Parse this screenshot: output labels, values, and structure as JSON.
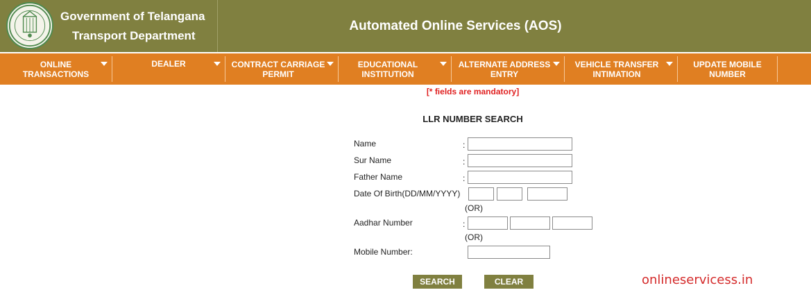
{
  "header": {
    "org_line1": "Government of Telangana",
    "org_line2": "Transport Department",
    "app_title": "Automated Online Services (AOS)",
    "emblem_icon": "telangana-state-emblem",
    "bg_color": "#808040"
  },
  "nav": {
    "bg_color": "#e07f22",
    "items": [
      {
        "label": "ONLINE TRANSACTIONS",
        "has_dropdown": true
      },
      {
        "label": "DEALER",
        "has_dropdown": true
      },
      {
        "label": "CONTRACT CARRIAGE PERMIT",
        "has_dropdown": true
      },
      {
        "label": "EDUCATIONAL INSTITUTION",
        "has_dropdown": true
      },
      {
        "label": "ALTERNATE ADDRESS ENTRY",
        "has_dropdown": true
      },
      {
        "label": "VEHICLE TRANSFER INTIMATION",
        "has_dropdown": true
      },
      {
        "label": "UPDATE MOBILE NUMBER",
        "has_dropdown": false
      }
    ]
  },
  "form": {
    "mandatory_note": "[* fields are mandatory]",
    "title": "LLR NUMBER SEARCH",
    "colon": ":",
    "fields": {
      "name": {
        "label": "Name",
        "value": ""
      },
      "surname": {
        "label": "Sur Name",
        "value": ""
      },
      "father_name": {
        "label": "Father Name",
        "value": ""
      },
      "dob": {
        "label": "Date Of Birth(DD/MM/YYYY)",
        "dd": "",
        "mm": "",
        "yyyy": ""
      },
      "aadhar": {
        "label": "Aadhar Number",
        "part1": "",
        "part2": "",
        "part3": ""
      },
      "mobile": {
        "label": "Mobile Number:",
        "value": ""
      }
    },
    "or_text": "(OR)",
    "search_button": "SEARCH",
    "clear_button": "CLEAR"
  },
  "watermark": "onlineservicess.in"
}
